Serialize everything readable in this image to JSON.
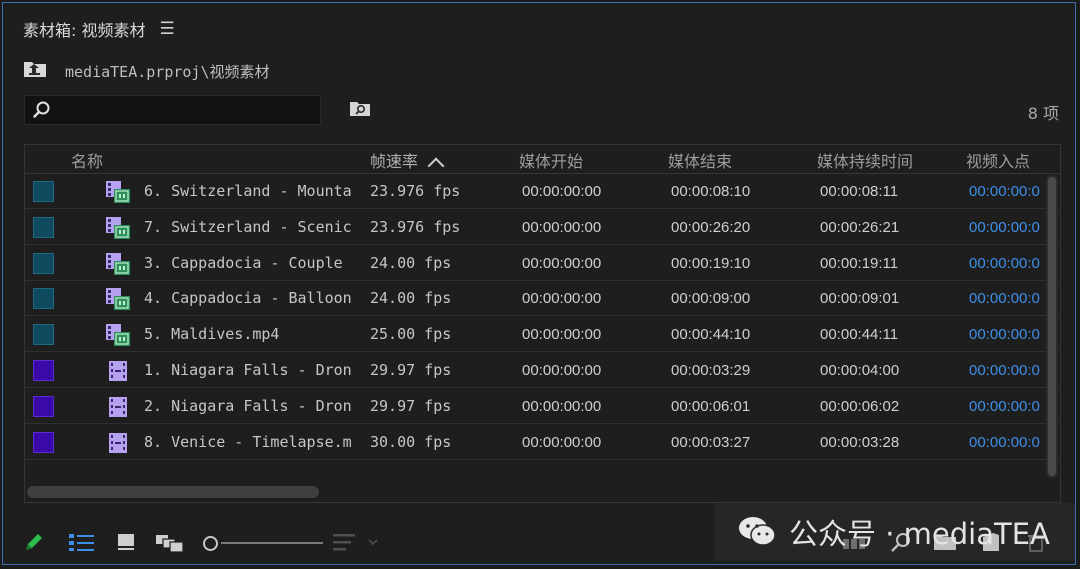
{
  "panel": {
    "title": "素材箱: 视频素材",
    "menu_icon": "hamburger-menu-icon"
  },
  "path": "mediaTEA.prproj\\视频素材",
  "search": {
    "value": "",
    "placeholder": ""
  },
  "item_count": "8 项",
  "columns": [
    "名称",
    "帧速率",
    "媒体开始",
    "媒体结束",
    "媒体持续时间",
    "视频入点"
  ],
  "sorted_column": "帧速率",
  "rows": [
    {
      "label_color": "#0f4a5e",
      "clip_type": "sequence",
      "name": "6. Switzerland - Mounta",
      "fps": "23.976 fps",
      "media_start": "00:00:00:00",
      "media_end": "00:00:08:10",
      "duration": "00:00:08:11",
      "video_in": "00:00:00:0"
    },
    {
      "label_color": "#0f4a5e",
      "clip_type": "sequence",
      "name": "7. Switzerland - Scenic",
      "fps": "23.976 fps",
      "media_start": "00:00:00:00",
      "media_end": "00:00:26:20",
      "duration": "00:00:26:21",
      "video_in": "00:00:00:0"
    },
    {
      "label_color": "#0f4a5e",
      "clip_type": "sequence",
      "name": "3. Cappadocia - Couple",
      "fps": "24.00 fps",
      "media_start": "00:00:00:00",
      "media_end": "00:00:19:10",
      "duration": "00:00:19:11",
      "video_in": "00:00:00:0"
    },
    {
      "label_color": "#0f4a5e",
      "clip_type": "sequence",
      "name": "4. Cappadocia - Balloon",
      "fps": "24.00 fps",
      "media_start": "00:00:00:00",
      "media_end": "00:00:09:00",
      "duration": "00:00:09:01",
      "video_in": "00:00:00:0"
    },
    {
      "label_color": "#0f4a5e",
      "clip_type": "sequence",
      "name": "5. Maldives.mp4",
      "fps": "25.00 fps",
      "media_start": "00:00:00:00",
      "media_end": "00:00:44:10",
      "duration": "00:00:44:11",
      "video_in": "00:00:00:0"
    },
    {
      "label_color": "#3a0aa8",
      "clip_type": "clip",
      "name": "1. Niagara Falls - Dron",
      "fps": "29.97 fps",
      "media_start": "00:00:00:00",
      "media_end": "00:00:03:29",
      "duration": "00:00:04:00",
      "video_in": "00:00:00:0"
    },
    {
      "label_color": "#3a0aa8",
      "clip_type": "clip",
      "name": "2. Niagara Falls - Dron",
      "fps": "29.97 fps",
      "media_start": "00:00:00:00",
      "media_end": "00:00:06:01",
      "duration": "00:00:06:02",
      "video_in": "00:00:00:0"
    },
    {
      "label_color": "#3a0aa8",
      "clip_type": "clip",
      "name": "8. Venice - Timelapse.m",
      "fps": "30.00 fps",
      "media_start": "00:00:00:00",
      "media_end": "00:00:03:27",
      "duration": "00:00:03:28",
      "video_in": "00:00:00:0"
    }
  ],
  "footer": {
    "icons": [
      "pencil-icon",
      "list-view-icon",
      "icon-view-icon",
      "freeform-view-icon",
      "zoom-slider",
      "sort-icon",
      "bin-icon",
      "search-icon",
      "new-bin-icon",
      "new-item-icon",
      "trash-icon"
    ]
  },
  "watermark": {
    "text": "公众号 · mediaTEA"
  },
  "colors": {
    "accent_blue": "#3d8fe6",
    "pencil_green": "#2fbf4f",
    "list_view_blue": "#3c8ee8"
  }
}
